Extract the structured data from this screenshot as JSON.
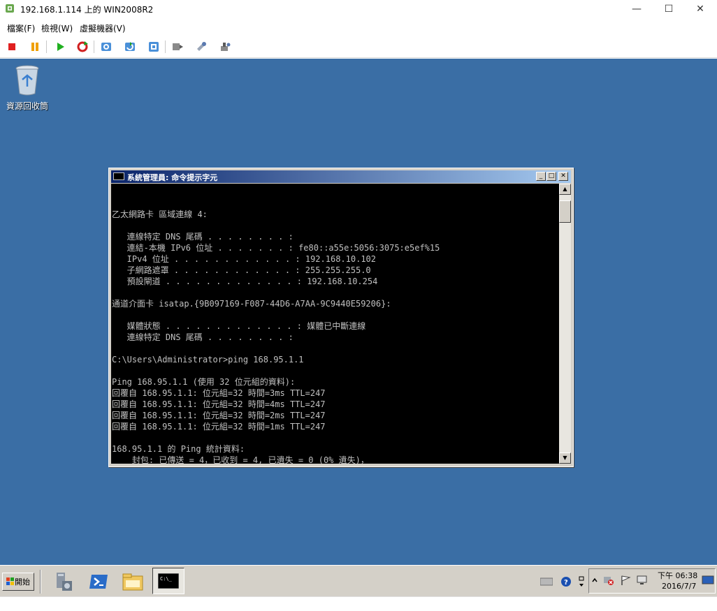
{
  "window": {
    "title": "192.168.1.114 上的 WIN2008R2",
    "minimize": "—",
    "maximize": "☐",
    "close": "✕"
  },
  "menu": [
    "檔案(F)",
    "檢視(W)",
    "虛擬機器(V)"
  ],
  "toolbar": [
    "stop-icon",
    "pause-icon",
    "play-icon",
    "reset-icon",
    "snapshot-icon",
    "revert-snapshot-icon",
    "snapshot-manager-icon",
    "usb-icon",
    "tools-icon",
    "settings-icon"
  ],
  "desktop": {
    "recycle_bin_label": "資源回收筒"
  },
  "cmd": {
    "title": "系統管理員: 命令提示字元",
    "lines": [
      "",
      "",
      "乙太網路卡 區域連線 4:",
      "",
      "   連線特定 DNS 尾碼 . . . . . . . . :",
      "   連結-本機 IPv6 位址 . . . . . . . : fe80::a55e:5056:3075:e5ef%15",
      "   IPv4 位址 . . . . . . . . . . . . : 192.168.10.102",
      "   子網路遮罩 . . . . . . . . . . . . : 255.255.255.0",
      "   預設閘道 . . . . . . . . . . . . . : 192.168.10.254",
      "",
      "通道介面卡 isatap.{9B097169-F087-44D6-A7AA-9C9440E59206}:",
      "",
      "   媒體狀態 . . . . . . . . . . . . . : 媒體已中斷連線",
      "   連線特定 DNS 尾碼 . . . . . . . . :",
      "",
      "C:\\Users\\Administrator>ping 168.95.1.1",
      "",
      "Ping 168.95.1.1 (使用 32 位元組的資料):",
      "回覆自 168.95.1.1: 位元組=32 時間=3ms TTL=247",
      "回覆自 168.95.1.1: 位元組=32 時間=4ms TTL=247",
      "回覆自 168.95.1.1: 位元組=32 時間=2ms TTL=247",
      "回覆自 168.95.1.1: 位元組=32 時間=1ms TTL=247",
      "",
      "168.95.1.1 的 Ping 統計資料:",
      "    封包: 已傳送 = 4，已收到 = 4, 已遺失 = 0 (0% 遺失)，"
    ]
  },
  "taskbar": {
    "start_label": "開始",
    "clock_time": "下午 06:38",
    "clock_date": "2016/7/7"
  }
}
